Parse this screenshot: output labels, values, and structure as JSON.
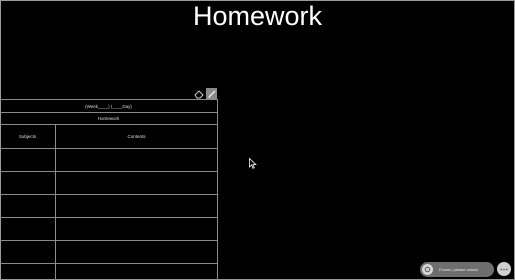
{
  "page": {
    "title": "Homework"
  },
  "toolbar": {
    "tools": [
      "eraser-icon",
      "pen-icon"
    ],
    "active_tool": "pen-icon"
  },
  "sheet": {
    "week_line": "(Week____)   (____Day)",
    "title": "Homework",
    "columns": [
      "Subjects",
      "Contents"
    ],
    "rows": [
      {
        "subject": "",
        "content": ""
      },
      {
        "subject": "",
        "content": ""
      },
      {
        "subject": "",
        "content": ""
      },
      {
        "subject": "",
        "content": ""
      },
      {
        "subject": "",
        "content": ""
      },
      {
        "subject": "",
        "content": ""
      }
    ]
  },
  "status_pill": {
    "icon": "settings-icon",
    "text": "Frozen, please unlock"
  },
  "corner_button": {
    "icon": "more-icon"
  },
  "colors": {
    "background": "#000000",
    "grid": "#8a8a8a",
    "pill": "#6e6e6e"
  }
}
